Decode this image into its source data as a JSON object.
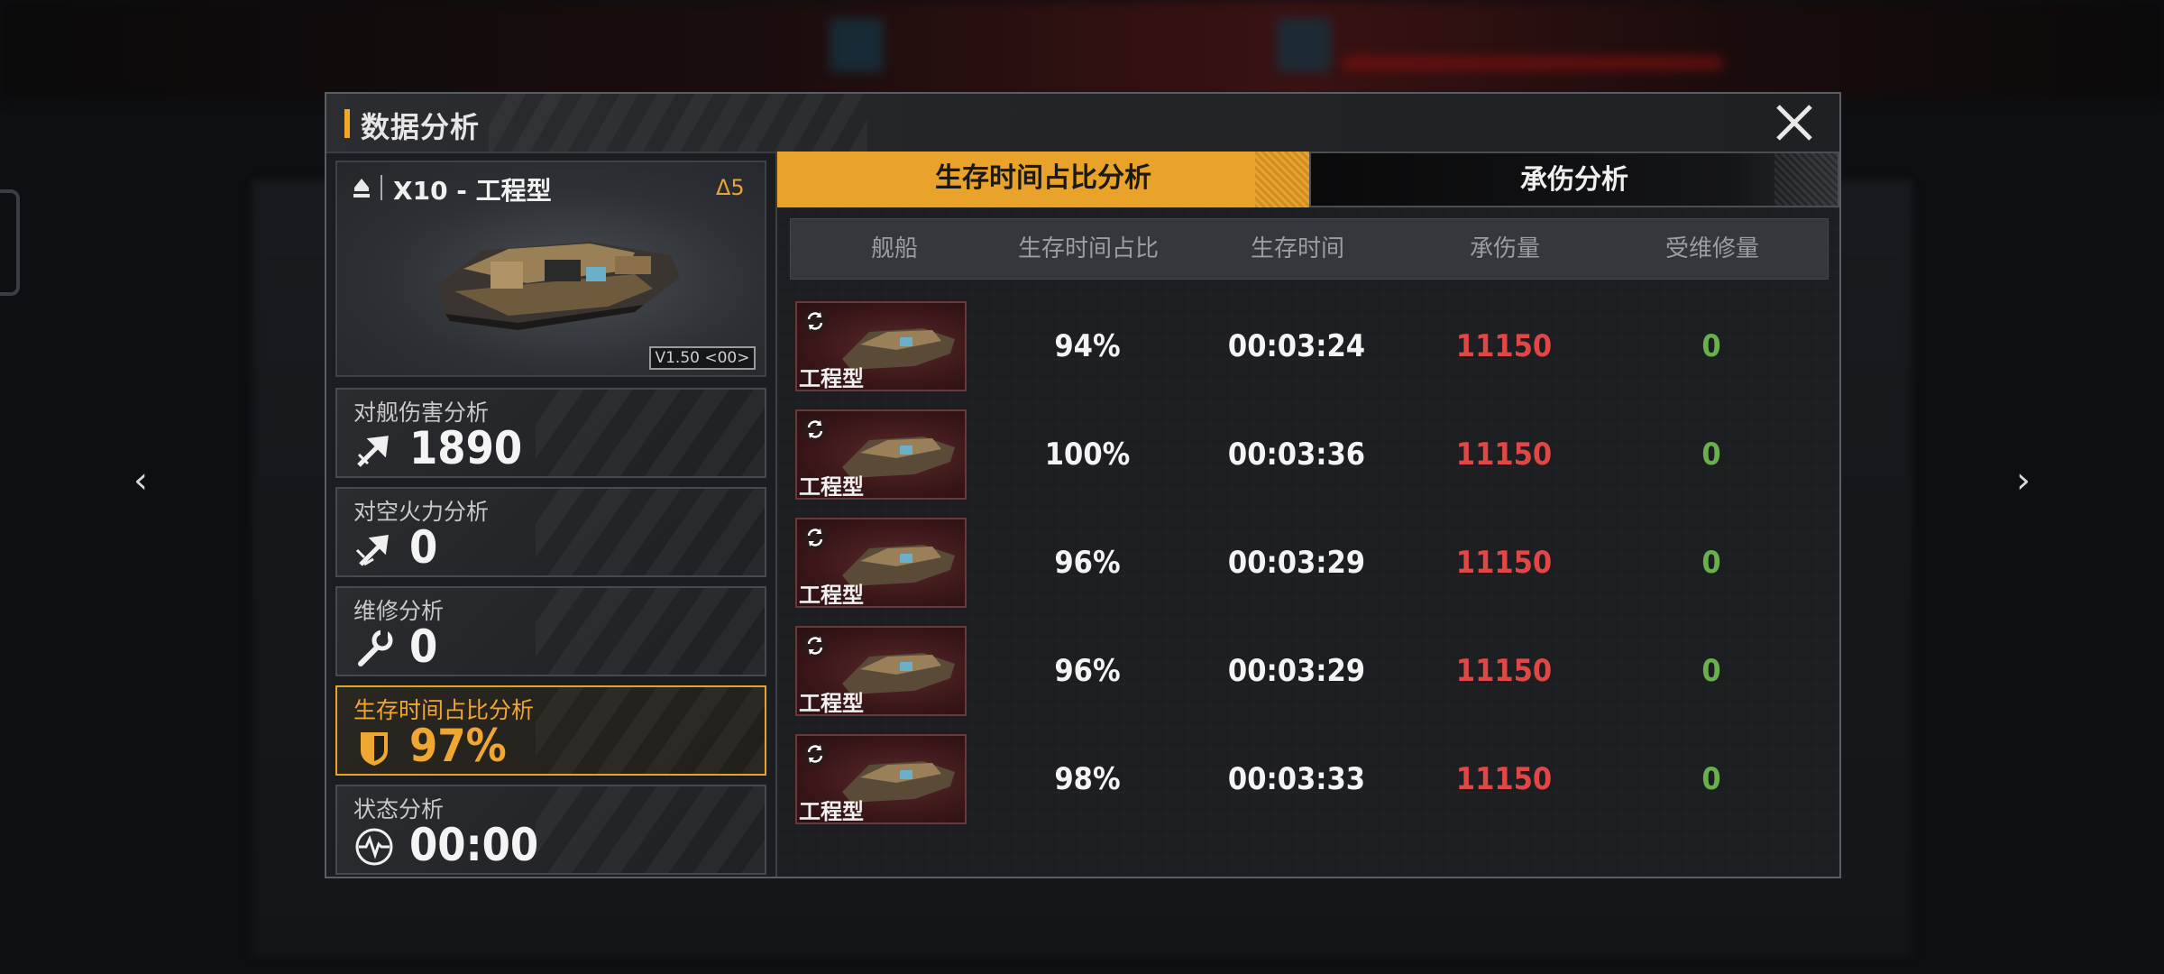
{
  "dialog": {
    "title": "数据分析"
  },
  "ship": {
    "name": "X10 - 工程型",
    "level": "Δ5",
    "version": "V1.50 <00>"
  },
  "stats": [
    {
      "label": "对舰伤害分析",
      "value": "1890",
      "icon": "damage-arrow-icon"
    },
    {
      "label": "对空火力分析",
      "value": "0",
      "icon": "anti-air-arrow-icon"
    },
    {
      "label": "维修分析",
      "value": "0",
      "icon": "wrench-icon"
    },
    {
      "label": "生存时间占比分析",
      "value": "97%",
      "icon": "shield-icon",
      "active": true
    },
    {
      "label": "状态分析",
      "value": "00:00",
      "icon": "pulse-icon"
    }
  ],
  "tabs": [
    {
      "label": "生存时间占比分析",
      "active": true
    },
    {
      "label": "承伤分析",
      "active": false
    }
  ],
  "table": {
    "headers": [
      "舰船",
      "生存时间占比",
      "生存时间",
      "承伤量",
      "受维修量"
    ],
    "rows": [
      {
        "ship": "工程型",
        "pct": "94%",
        "time": "00:03:24",
        "damage": "11150",
        "repair": "0"
      },
      {
        "ship": "工程型",
        "pct": "100%",
        "time": "00:03:36",
        "damage": "11150",
        "repair": "0"
      },
      {
        "ship": "工程型",
        "pct": "96%",
        "time": "00:03:29",
        "damage": "11150",
        "repair": "0"
      },
      {
        "ship": "工程型",
        "pct": "96%",
        "time": "00:03:29",
        "damage": "11150",
        "repair": "0"
      },
      {
        "ship": "工程型",
        "pct": "98%",
        "time": "00:03:33",
        "damage": "11150",
        "repair": "0"
      }
    ]
  },
  "nav": {
    "prev": "‹",
    "next": "›"
  },
  "colors": {
    "accent": "#e9a22a",
    "damage": "#e04848",
    "repair": "#6ab04c"
  }
}
